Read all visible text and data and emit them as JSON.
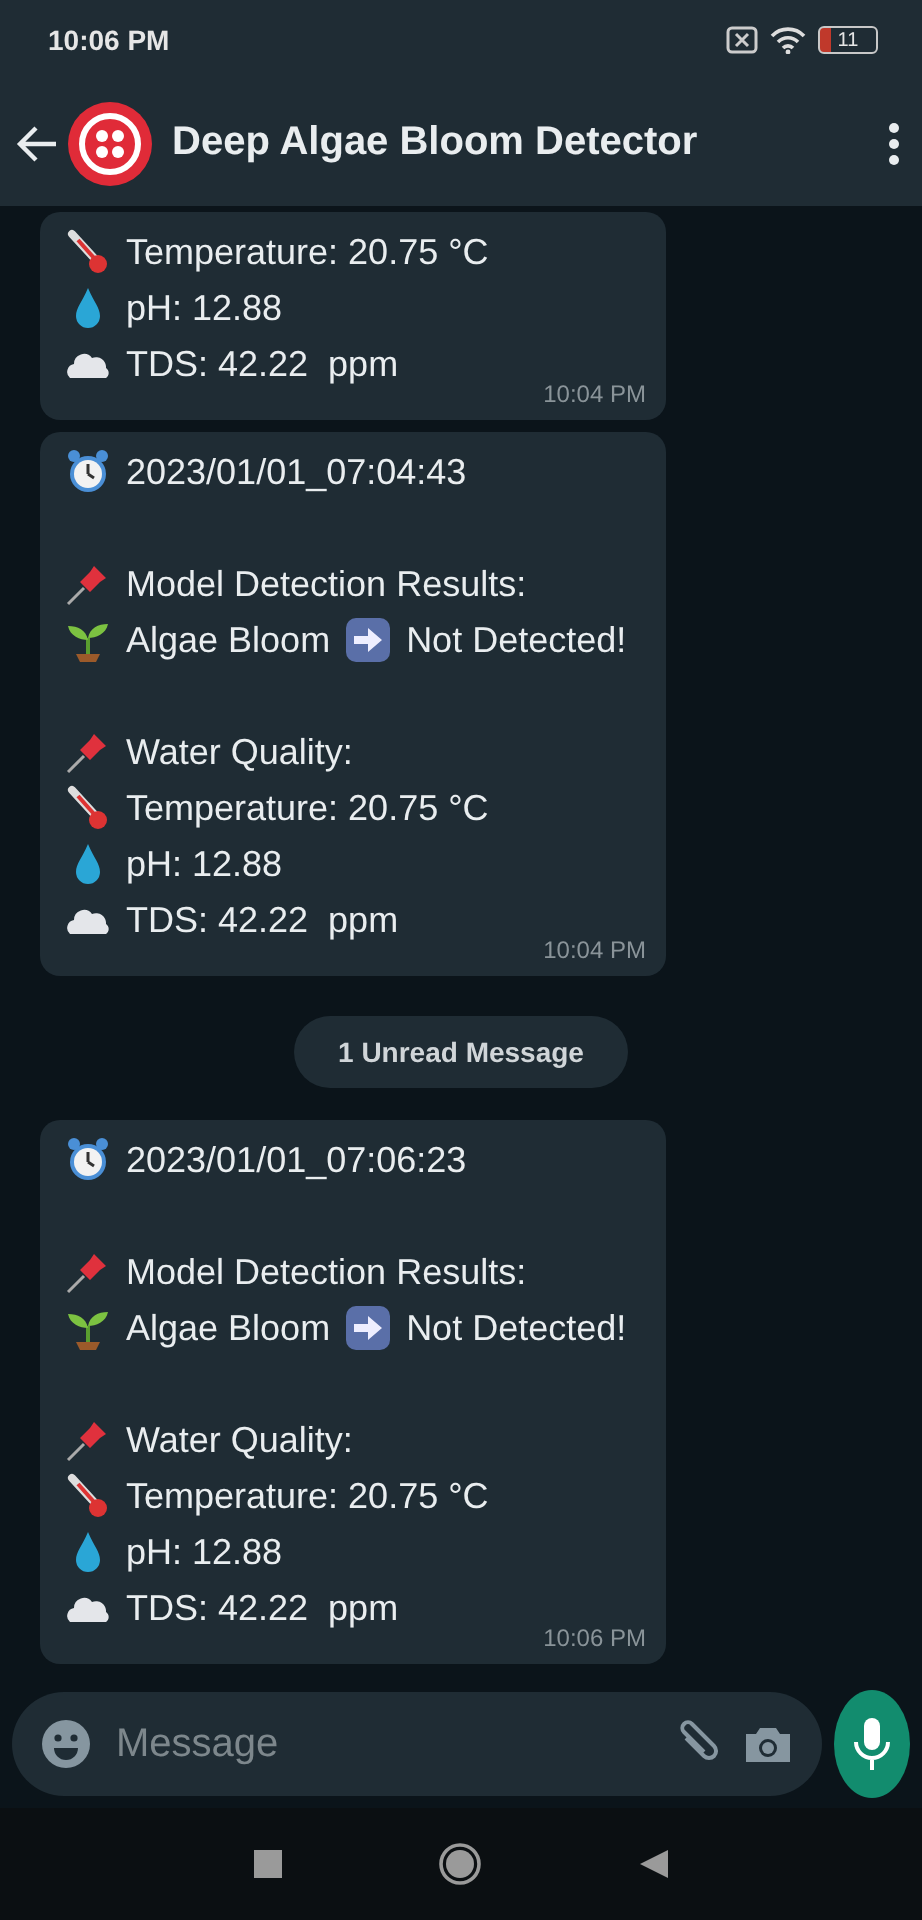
{
  "status_bar": {
    "time": "10:06 PM",
    "battery": "11"
  },
  "header": {
    "title": "Deep Algae Bloom Detector"
  },
  "messages": [
    {
      "kind": "message",
      "time": "10:04 PM",
      "lines": [
        {
          "kind": "thermometer",
          "text": "Temperature: 20.75 °C"
        },
        {
          "kind": "drop",
          "text": "pH: 12.88"
        },
        {
          "kind": "cloud",
          "text": "TDS: 42.22  ppm"
        }
      ]
    },
    {
      "kind": "message",
      "time": "10:04 PM",
      "lines": [
        {
          "kind": "clock",
          "text": "2023/01/01_07:04:43"
        },
        {
          "kind": "blank"
        },
        {
          "kind": "pin",
          "text": "Model Detection Results:"
        },
        {
          "kind": "result",
          "text": "Algae Bloom",
          "result": "Not Detected!"
        },
        {
          "kind": "blank"
        },
        {
          "kind": "pin",
          "text": "Water Quality:"
        },
        {
          "kind": "thermometer",
          "text": "Temperature: 20.75 °C"
        },
        {
          "kind": "drop",
          "text": "pH: 12.88"
        },
        {
          "kind": "cloud",
          "text": "TDS: 42.22  ppm"
        }
      ]
    },
    {
      "kind": "divider",
      "text": "1 Unread Message"
    },
    {
      "kind": "message",
      "time": "10:06 PM",
      "lines": [
        {
          "kind": "clock",
          "text": "2023/01/01_07:06:23"
        },
        {
          "kind": "blank"
        },
        {
          "kind": "pin",
          "text": "Model Detection Results:"
        },
        {
          "kind": "result",
          "text": "Algae Bloom",
          "result": "Not Detected!"
        },
        {
          "kind": "blank"
        },
        {
          "kind": "pin",
          "text": "Water Quality:"
        },
        {
          "kind": "thermometer",
          "text": "Temperature: 20.75 °C"
        },
        {
          "kind": "drop",
          "text": "pH: 12.88"
        },
        {
          "kind": "cloud",
          "text": "TDS: 42.22  ppm"
        }
      ]
    }
  ],
  "composer": {
    "placeholder": "Message"
  }
}
